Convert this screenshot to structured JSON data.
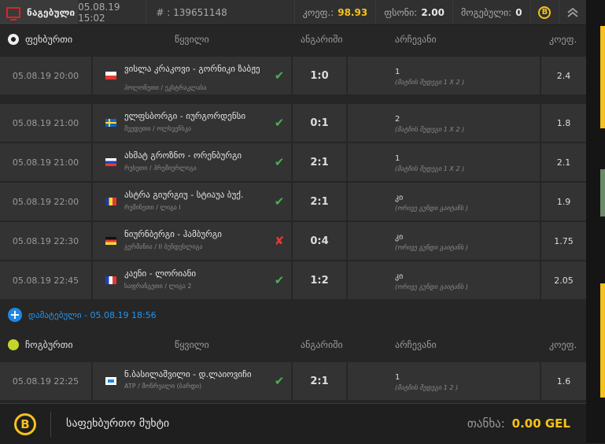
{
  "topbar": {
    "title": "ნაგებული",
    "datetime": "05.08.19 15:02",
    "ticket": "# : 139651148",
    "coef_label": "კოეფ.:",
    "coef_value": "98.93",
    "bonus_label": "ფსონი:",
    "bonus_value": "2.00",
    "win_label": "მოგებული:",
    "win_value": "0",
    "badge": "B"
  },
  "sections": [
    {
      "sport": "ფეხბურთი",
      "col_match": "წყვილი",
      "col_score": "ანგარიში",
      "col_pick": "არჩევანი",
      "col_odd": "კოეფ."
    },
    {
      "sport": "ჩოგბურთი",
      "col_match": "წყვილი",
      "col_score": "ანგარიში",
      "col_pick": "არჩევანი",
      "col_odd": "კოეფ."
    }
  ],
  "rows": [
    {
      "date": "05.08.19 20:00",
      "teams": "ვისლა კრაკოვი - გორნიკი ზაბჟე",
      "league": "პოლონეთი / ეკსტრაკლასა",
      "score": "1:0",
      "pick": "1",
      "pick_desc": "(მატჩის შედეგი 1 X 2 )",
      "odd": "2.4",
      "result": "✔"
    },
    {
      "date": "05.08.19 21:00",
      "teams": "ელფსბორგი - იურგორდენსი",
      "league": "შვედეთი / ოლსვენსკა",
      "score": "0:1",
      "pick": "2",
      "pick_desc": "(მატჩის შედეგი 1 X 2 )",
      "odd": "1.8",
      "result": "✔"
    },
    {
      "date": "05.08.19 21:00",
      "teams": "ახმატ გროზნო - ორენბურგი",
      "league": "რუსეთი / პრემიერლიგა",
      "score": "2:1",
      "pick": "1",
      "pick_desc": "(მატჩის შედეგი 1 X 2 )",
      "odd": "2.1",
      "result": "✔"
    },
    {
      "date": "05.08.19 22:00",
      "teams": "ასტრა გიურგიუ - სტიაუა ბუქ.",
      "league": "რუმინეთი / ლიგა I",
      "score": "2:1",
      "pick": "კი",
      "pick_desc": "(ორივე გუნდი გაიტანს )",
      "odd": "1.9",
      "result": "✔"
    },
    {
      "date": "05.08.19 22:30",
      "teams": "ნიურნბერგი - ჰამბურგი",
      "league": "გერმანია / II ბუნდესლიგა",
      "score": "0:4",
      "pick": "კი",
      "pick_desc": "(ორივე გუნდი გაიტანს )",
      "odd": "1.75",
      "result": "✘"
    },
    {
      "date": "05.08.19 22:45",
      "teams": "კაენი - ლორიანი",
      "league": "საფრანგეთი / ლიგა 2",
      "score": "1:2",
      "pick": "კი",
      "pick_desc": "(ორივე გუნდი გაიტანს )",
      "odd": "2.05",
      "result": "✔"
    },
    {
      "date": "05.08.19 22:25",
      "teams": "ნ.ბასილაშვილი - დ.ლაიოვიჩი",
      "league": "ATP / მონრეალი (ბარდი)",
      "score": "2:1",
      "pick": "1",
      "pick_desc": "(მატჩის შედეგი 1 2 )",
      "odd": "1.6",
      "result": "✔"
    }
  ],
  "added": {
    "plus": "+",
    "label": "დამატებული - 05.08.19 18:56"
  },
  "footer": {
    "badge": "B",
    "label": "საფეხბურთო მუხტი",
    "total_label": "თანხა:",
    "total_value": "0.00 GEL"
  }
}
